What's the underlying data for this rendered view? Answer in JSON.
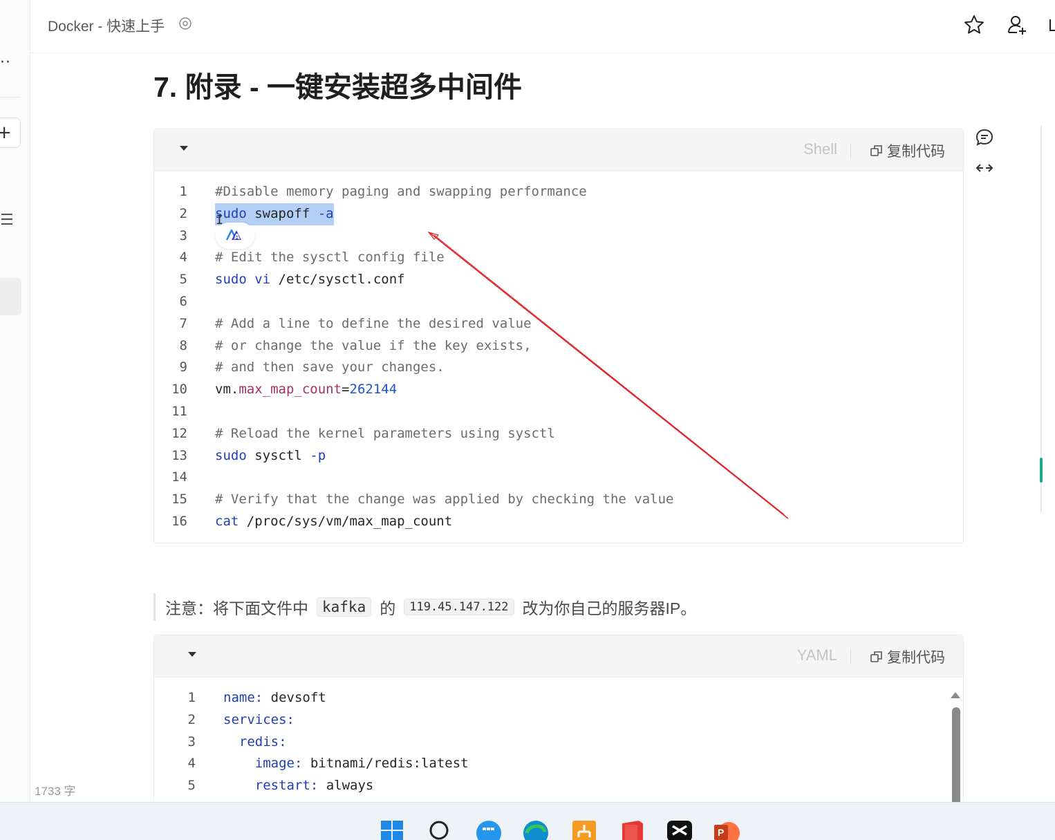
{
  "header": {
    "doc_title": "Docker - 快速上手"
  },
  "heading": "7. 附录 - 一键安装超多中间件",
  "code_block_1": {
    "lang": "Shell",
    "copy_label": "复制代码",
    "lines": [
      {
        "n": "1",
        "text": "#Disable memory paging and swapping performance"
      },
      {
        "n": "2",
        "text": "sudo swapoff -a"
      },
      {
        "n": "3",
        "text": ""
      },
      {
        "n": "4",
        "text": "# Edit the sysctl config file"
      },
      {
        "n": "5",
        "text": "sudo vi /etc/sysctl.conf"
      },
      {
        "n": "6",
        "text": ""
      },
      {
        "n": "7",
        "text": "# Add a line to define the desired value"
      },
      {
        "n": "8",
        "text": "# or change the value if the key exists,"
      },
      {
        "n": "9",
        "text": "# and then save your changes."
      },
      {
        "n": "10",
        "text": "vm.max_map_count=262144"
      },
      {
        "n": "11",
        "text": ""
      },
      {
        "n": "12",
        "text": "# Reload the kernel parameters using sysctl"
      },
      {
        "n": "13",
        "text": "sudo sysctl -p"
      },
      {
        "n": "14",
        "text": ""
      },
      {
        "n": "15",
        "text": "# Verify that the change was applied by checking the value"
      },
      {
        "n": "16",
        "text": "cat /proc/sys/vm/max_map_count"
      }
    ]
  },
  "note": {
    "prefix": "注意：将下面文件中",
    "code1": "kafka",
    "middle": "的",
    "code2": "119.45.147.122",
    "suffix": "改为你自己的服务器IP。"
  },
  "code_block_2": {
    "lang": "YAML",
    "copy_label": "复制代码",
    "lines": [
      {
        "n": "1",
        "text": "name: devsoft"
      },
      {
        "n": "2",
        "text": "services:"
      },
      {
        "n": "3",
        "text": "  redis:"
      },
      {
        "n": "4",
        "text": "    image: bitnami/redis:latest"
      },
      {
        "n": "5",
        "text": "    restart: always"
      }
    ]
  },
  "footer": {
    "word_count": "1733 字"
  },
  "colors": {
    "selection": "#b3cff5",
    "keyword": "#1f3fb5",
    "annotation_arrow": "#e0242b",
    "scroll_accent": "#1aa98a"
  },
  "icons": [
    "more-icon",
    "plus-icon",
    "list-icon",
    "settings-icon",
    "star-icon",
    "add-user-icon",
    "comment-icon",
    "expand-icon",
    "copy-icon",
    "caret-down-icon",
    "translate-icon",
    "windows-start-icon",
    "search-icon",
    "docker-icon",
    "edge-icon",
    "app-icon",
    "book-icon",
    "capcut-icon",
    "powerpoint-icon"
  ]
}
